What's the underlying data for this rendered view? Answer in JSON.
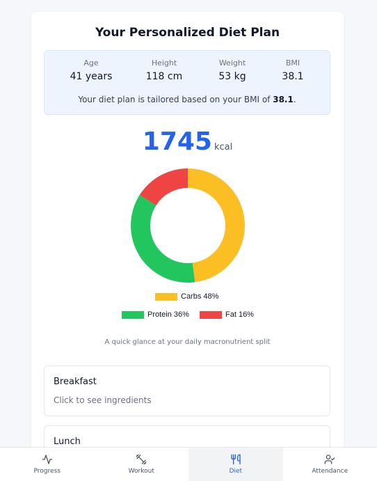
{
  "title": "Your Personalized Diet Plan",
  "stats": [
    {
      "label": "Age",
      "value": "41 years"
    },
    {
      "label": "Height",
      "value": "118 cm"
    },
    {
      "label": "Weight",
      "value": "53 kg"
    },
    {
      "label": "BMI",
      "value": "38.1"
    }
  ],
  "note": {
    "prefix": "Your diet plan is tailored based on your BMI of ",
    "bmi": "38.1",
    "suffix": "."
  },
  "calories": {
    "value": "1745",
    "unit": "kcal"
  },
  "chart_data": {
    "type": "pie",
    "donut": true,
    "slices": [
      {
        "label": "Carbs 48%",
        "value": 48,
        "color": "#fbbf24"
      },
      {
        "label": "Protein 36%",
        "value": 36,
        "color": "#22c55e"
      },
      {
        "label": "Fat 16%",
        "value": 16,
        "color": "#ef4444"
      }
    ],
    "legend": "bottom"
  },
  "caption": "A quick glance at your daily macronutrient split",
  "meals": [
    {
      "name": "Breakfast",
      "hint": "Click to see ingredients"
    },
    {
      "name": "Lunch"
    }
  ],
  "nav": [
    {
      "label": "Progress",
      "icon": "activity-icon"
    },
    {
      "label": "Workout",
      "icon": "dumbbell-icon"
    },
    {
      "label": "Diet",
      "icon": "utensils-icon",
      "active": true
    },
    {
      "label": "Attendance",
      "icon": "user-check-icon"
    }
  ],
  "colors": {
    "accent": "#2563eb",
    "panel": "#eef4fd"
  }
}
